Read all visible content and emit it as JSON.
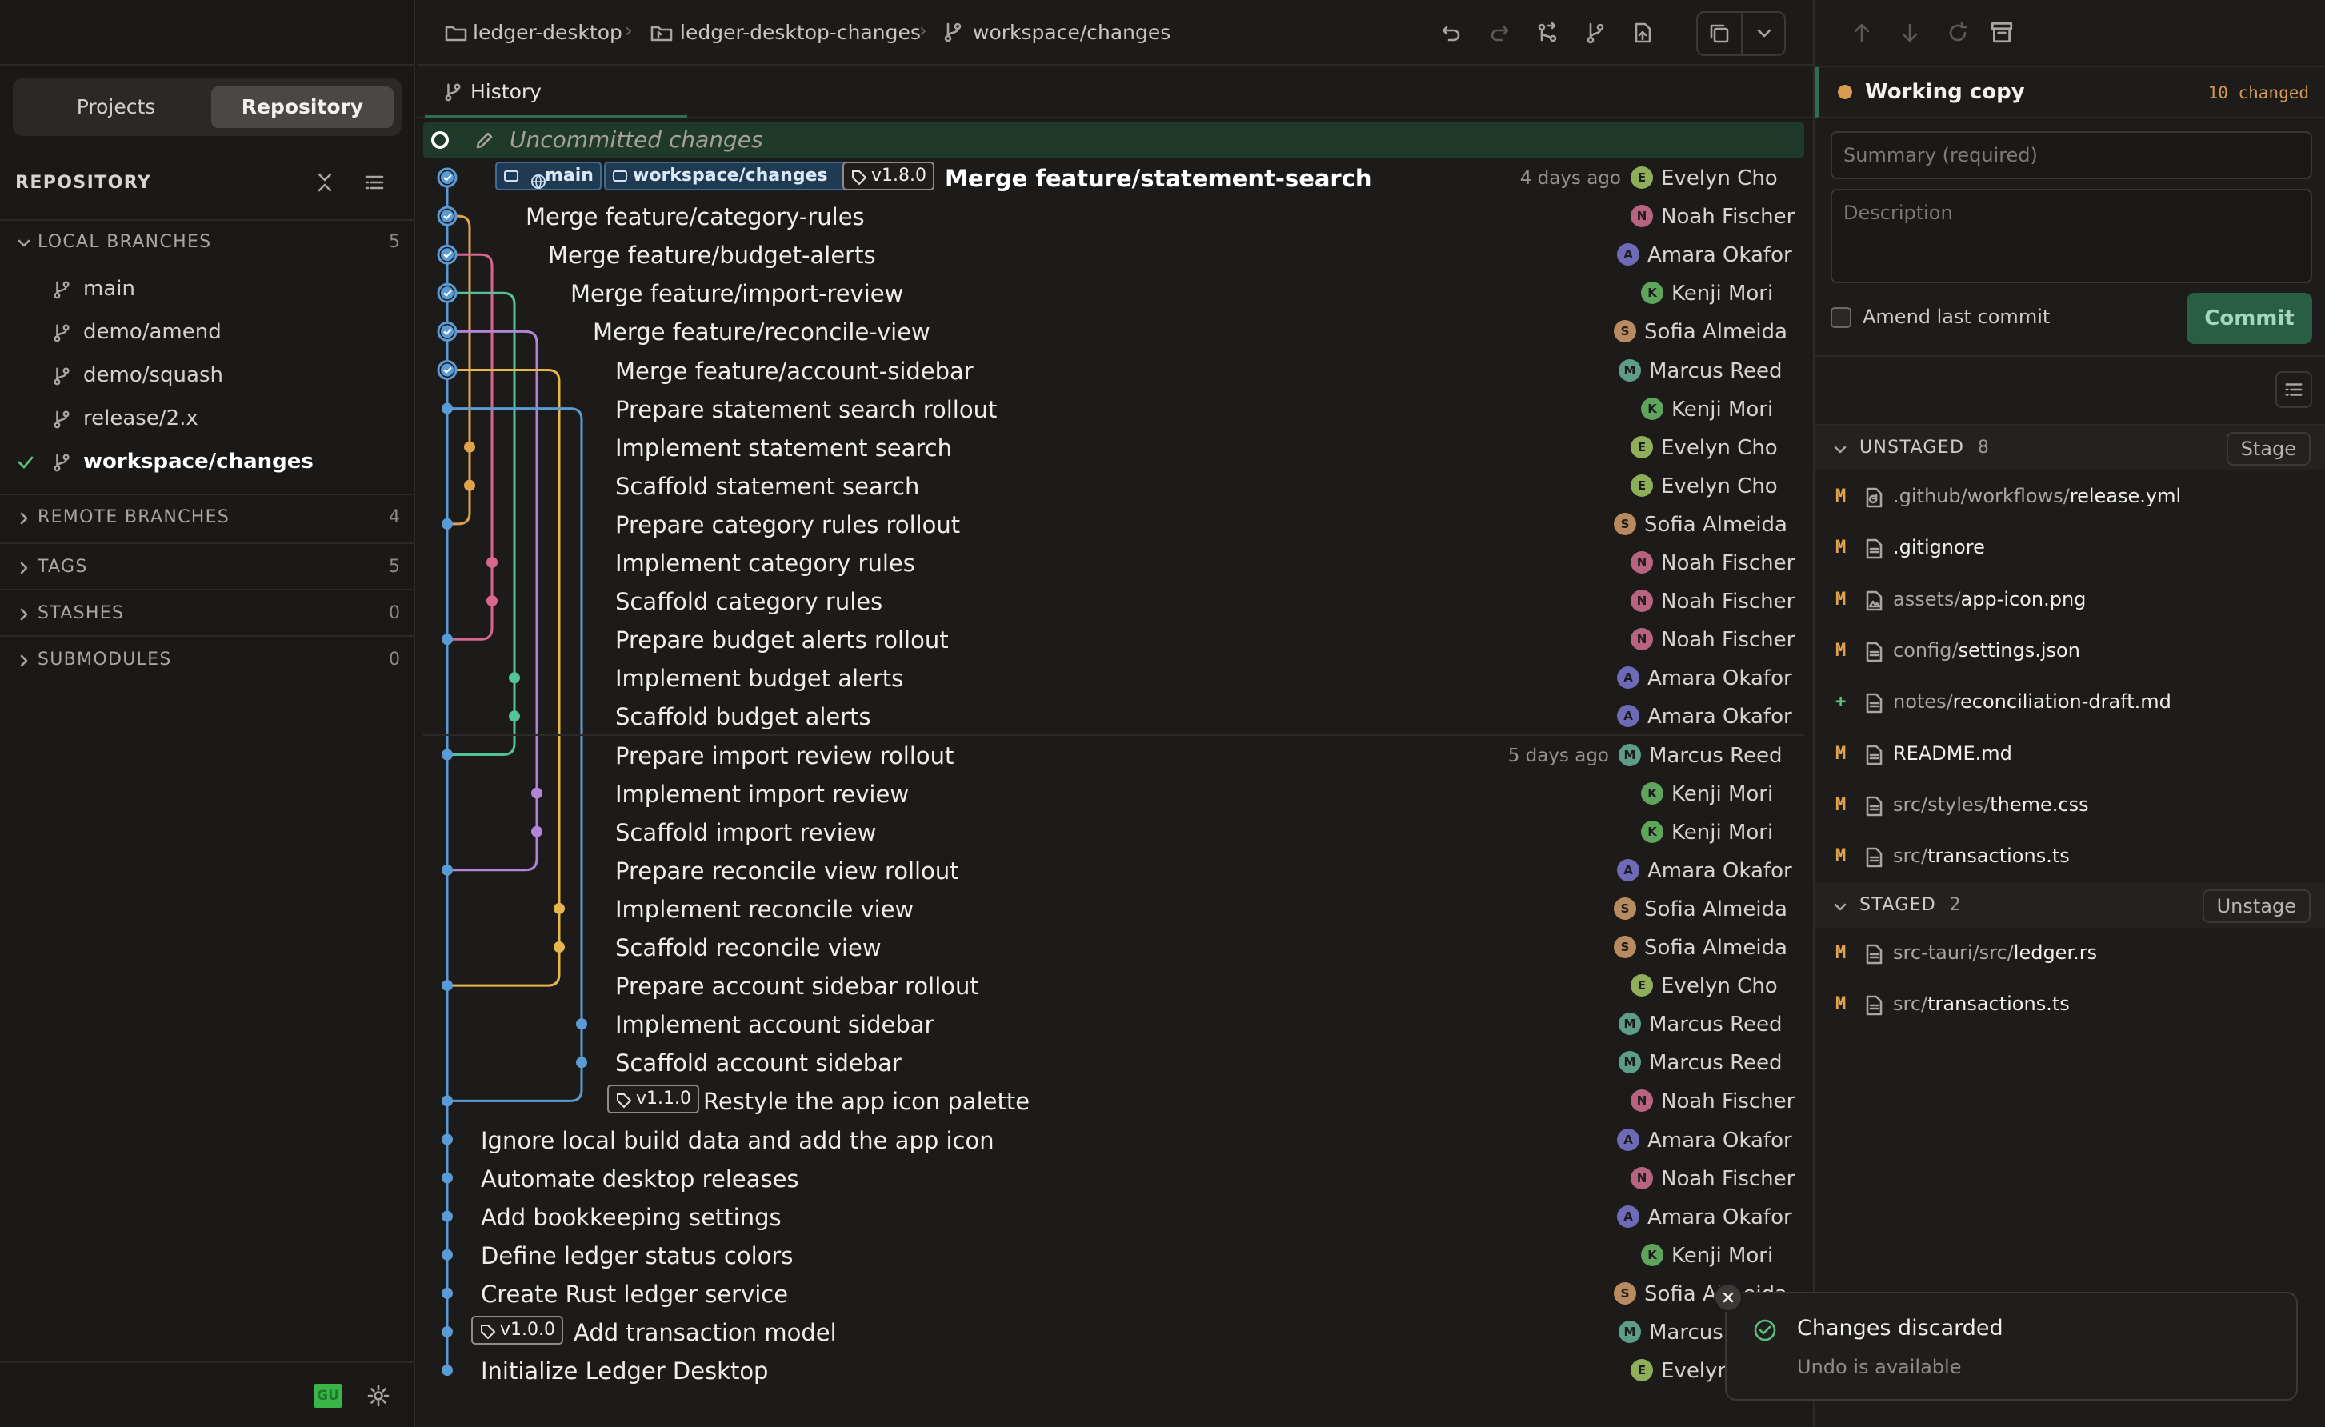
{
  "sidebar": {
    "tabs": [
      "Projects",
      "Repository"
    ],
    "repo_heading": "REPOSITORY",
    "local_branches_label": "LOCAL BRANCHES",
    "local_branches_count": "5",
    "branches": [
      "main",
      "demo/amend",
      "demo/squash",
      "release/2.x",
      "workspace/changes"
    ],
    "active_branch": "workspace/changes",
    "sections": [
      {
        "label": "REMOTE BRANCHES",
        "count": "4"
      },
      {
        "label": "TAGS",
        "count": "5"
      },
      {
        "label": "STASHES",
        "count": "0"
      },
      {
        "label": "SUBMODULES",
        "count": "0"
      }
    ],
    "status_badge": "GU"
  },
  "breadcrumb": {
    "project": "ledger-desktop",
    "repo": "ledger-desktop-changes",
    "branch": "workspace/changes"
  },
  "tab": {
    "label": "History"
  },
  "history": {
    "uncommitted_label": "Uncommitted changes",
    "head_refs": {
      "local_main": "main",
      "local_branch": "workspace/changes",
      "tag": "v1.8.0"
    },
    "tags": {
      "restyle": "v1.1.0",
      "initial_model": "v1.0.0"
    },
    "commits": [
      {
        "message": "Merge feature/statement-search",
        "time": "4 days ago",
        "author": "Evelyn Cho",
        "initial": "E"
      },
      {
        "message": "Merge feature/category-rules",
        "time": "",
        "author": "Noah Fischer",
        "initial": "N"
      },
      {
        "message": "Merge feature/budget-alerts",
        "time": "",
        "author": "Amara Okafor",
        "initial": "A"
      },
      {
        "message": "Merge feature/import-review",
        "time": "",
        "author": "Kenji Mori",
        "initial": "K"
      },
      {
        "message": "Merge feature/reconcile-view",
        "time": "",
        "author": "Sofia Almeida",
        "initial": "S"
      },
      {
        "message": "Merge feature/account-sidebar",
        "time": "",
        "author": "Marcus Reed",
        "initial": "M"
      },
      {
        "message": "Prepare statement search rollout",
        "time": "",
        "author": "Kenji Mori",
        "initial": "K"
      },
      {
        "message": "Implement statement search",
        "time": "",
        "author": "Evelyn Cho",
        "initial": "E"
      },
      {
        "message": "Scaffold statement search",
        "time": "",
        "author": "Evelyn Cho",
        "initial": "E"
      },
      {
        "message": "Prepare category rules rollout",
        "time": "",
        "author": "Sofia Almeida",
        "initial": "S"
      },
      {
        "message": "Implement category rules",
        "time": "",
        "author": "Noah Fischer",
        "initial": "N"
      },
      {
        "message": "Scaffold category rules",
        "time": "",
        "author": "Noah Fischer",
        "initial": "N"
      },
      {
        "message": "Prepare budget alerts rollout",
        "time": "",
        "author": "Noah Fischer",
        "initial": "N"
      },
      {
        "message": "Implement budget alerts",
        "time": "",
        "author": "Amara Okafor",
        "initial": "A"
      },
      {
        "message": "Scaffold budget alerts",
        "time": "",
        "author": "Amara Okafor",
        "initial": "A"
      },
      {
        "message": "Prepare import review rollout",
        "time": "5 days ago",
        "author": "Marcus Reed",
        "initial": "M"
      },
      {
        "message": "Implement import review",
        "time": "",
        "author": "Kenji Mori",
        "initial": "K"
      },
      {
        "message": "Scaffold import review",
        "time": "",
        "author": "Kenji Mori",
        "initial": "K"
      },
      {
        "message": "Prepare reconcile view rollout",
        "time": "",
        "author": "Amara Okafor",
        "initial": "A"
      },
      {
        "message": "Implement reconcile view",
        "time": "",
        "author": "Sofia Almeida",
        "initial": "S"
      },
      {
        "message": "Scaffold reconcile view",
        "time": "",
        "author": "Sofia Almeida",
        "initial": "S"
      },
      {
        "message": "Prepare account sidebar rollout",
        "time": "",
        "author": "Evelyn Cho",
        "initial": "E"
      },
      {
        "message": "Implement account sidebar",
        "time": "",
        "author": "Marcus Reed",
        "initial": "M"
      },
      {
        "message": "Scaffold account sidebar",
        "time": "",
        "author": "Marcus Reed",
        "initial": "M"
      },
      {
        "message": "Restyle the app icon palette",
        "time": "",
        "author": "Noah Fischer",
        "initial": "N"
      },
      {
        "message": "Ignore local build data and add the app icon",
        "time": "",
        "author": "Amara Okafor",
        "initial": "A"
      },
      {
        "message": "Automate desktop releases",
        "time": "",
        "author": "Noah Fischer",
        "initial": "N"
      },
      {
        "message": "Add bookkeeping settings",
        "time": "",
        "author": "Amara Okafor",
        "initial": "A"
      },
      {
        "message": "Define ledger status colors",
        "time": "",
        "author": "Kenji Mori",
        "initial": "K"
      },
      {
        "message": "Create Rust ledger service",
        "time": "",
        "author": "Sofia Almeida",
        "initial": "S"
      },
      {
        "message": "Add transaction model",
        "time": "",
        "author": "Marcus Reed",
        "initial": "M"
      },
      {
        "message": "Initialize Ledger Desktop",
        "time": "",
        "author": "Evelyn Cho",
        "initial": "E"
      }
    ]
  },
  "working_copy": {
    "title": "Working copy",
    "changed": "10 changed",
    "summary_placeholder": "Summary (required)",
    "description_placeholder": "Description",
    "amend_label": "Amend last commit",
    "commit_label": "Commit",
    "unstaged_label": "UNSTAGED",
    "unstaged_count": "8",
    "stage_label": "Stage",
    "unstaged": [
      {
        "status": "M",
        "dir": ".github/workflows/",
        "name": "release.yml"
      },
      {
        "status": "M",
        "dir": "",
        "name": ".gitignore"
      },
      {
        "status": "M",
        "dir": "assets/",
        "name": "app-icon.png"
      },
      {
        "status": "M",
        "dir": "config/",
        "name": "settings.json"
      },
      {
        "status": "+",
        "dir": "notes/",
        "name": "reconciliation-draft.md"
      },
      {
        "status": "M",
        "dir": "",
        "name": "README.md"
      },
      {
        "status": "M",
        "dir": "src/styles/",
        "name": "theme.css"
      },
      {
        "status": "M",
        "dir": "src/",
        "name": "transactions.ts"
      }
    ],
    "staged_label": "STAGED",
    "staged_count": "2",
    "unstage_label": "Unstage",
    "staged": [
      {
        "status": "M",
        "dir": "src-tauri/src/",
        "name": "ledger.rs"
      },
      {
        "status": "M",
        "dir": "src/",
        "name": "transactions.ts"
      }
    ]
  },
  "toast": {
    "title": "Changes discarded",
    "subtitle": "Undo is available"
  },
  "colors": {
    "accent_green": "#2f6e4f",
    "lane_blue": "#5b9bd5",
    "lane_orange": "#e0a24a",
    "lane_pink": "#d9668f",
    "lane_teal": "#54c29a",
    "lane_purple": "#b184d8",
    "lane_yellow": "#e6b64c",
    "modified": "#e0a24a",
    "added": "#5fbf7f"
  }
}
